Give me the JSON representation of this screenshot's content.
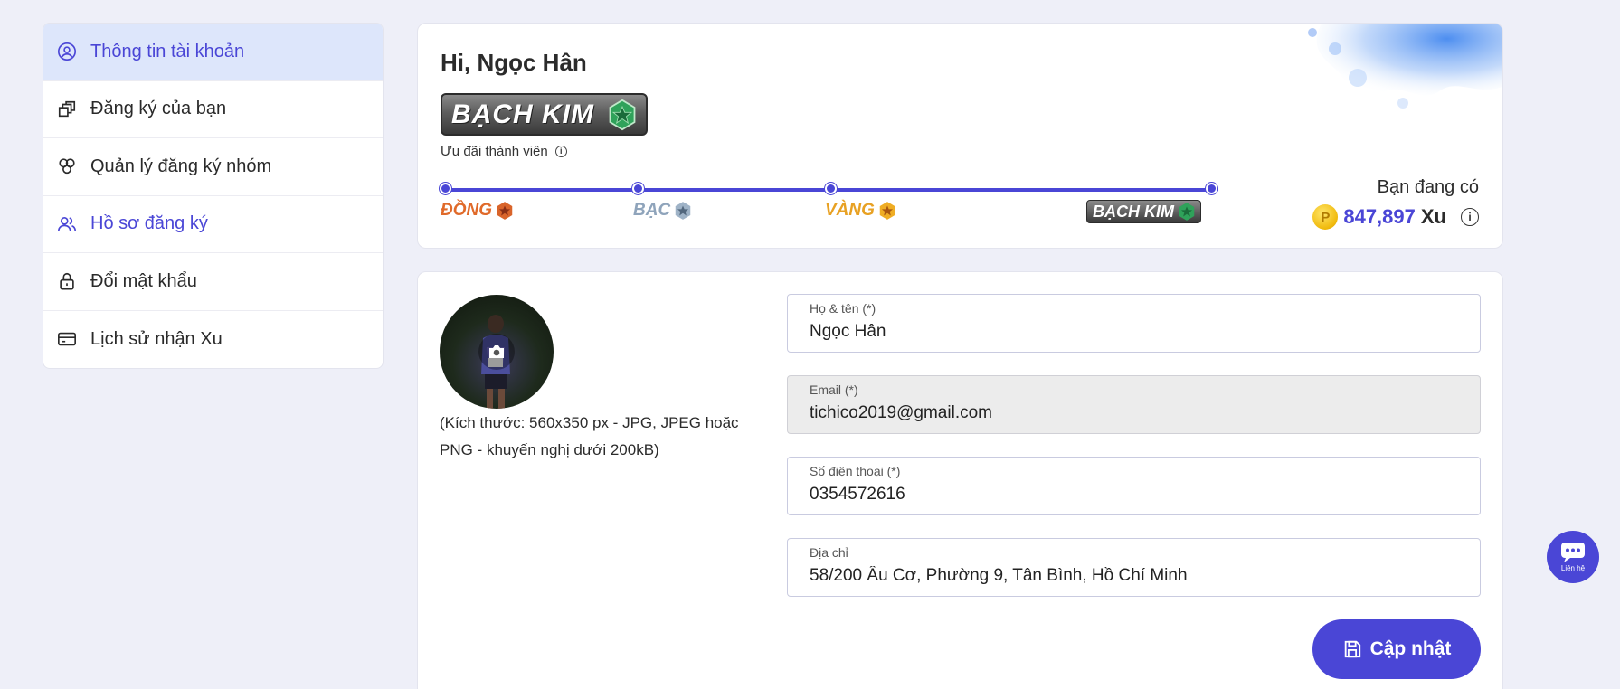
{
  "sidebar": {
    "items": [
      {
        "label": "Thông tin tài khoản",
        "icon": "user-circle-icon"
      },
      {
        "label": "Đăng ký của bạn",
        "icon": "stack-icon"
      },
      {
        "label": "Quản lý đăng ký nhóm",
        "icon": "group-circles-icon"
      },
      {
        "label": "Hồ sơ đăng ký",
        "icon": "users-icon"
      },
      {
        "label": "Đổi mật khẩu",
        "icon": "lock-icon"
      },
      {
        "label": "Lịch sử nhận Xu",
        "icon": "card-icon"
      }
    ]
  },
  "summary": {
    "greeting": "Hi, Ngọc Hân",
    "current_tier": "BẠCH KIM",
    "member_perk_label": "Ưu đãi thành viên",
    "tiers": [
      "ĐỒNG",
      "BẠC",
      "VÀNG",
      "BẠCH KIM"
    ],
    "balance_label": "Bạn đang có",
    "balance_amount": "847,897",
    "balance_unit": "Xu",
    "coin_symbol": "P"
  },
  "profile": {
    "avatar_hint": "(Kích thước: 560x350 px - JPG, JPEG hoặc PNG - khuyến nghị dưới 200kB)",
    "fields": {
      "name": {
        "label": "Họ & tên (*)",
        "value": "Ngọc Hân"
      },
      "email": {
        "label": "Email (*)",
        "value": "tichico2019@gmail.com"
      },
      "phone": {
        "label": "Số điện thoại (*)",
        "value": "0354572616"
      },
      "address": {
        "label": "Địa chỉ",
        "value": "58/200 Âu Cơ, Phường 9, Tân Bình, Hồ Chí Minh"
      }
    },
    "update_label": "Cập nhật"
  },
  "contact": {
    "label": "Liên hệ"
  },
  "colors": {
    "accent": "#4a46d6",
    "active_bg": "#dde6fb",
    "page_bg": "#eeeff8"
  }
}
